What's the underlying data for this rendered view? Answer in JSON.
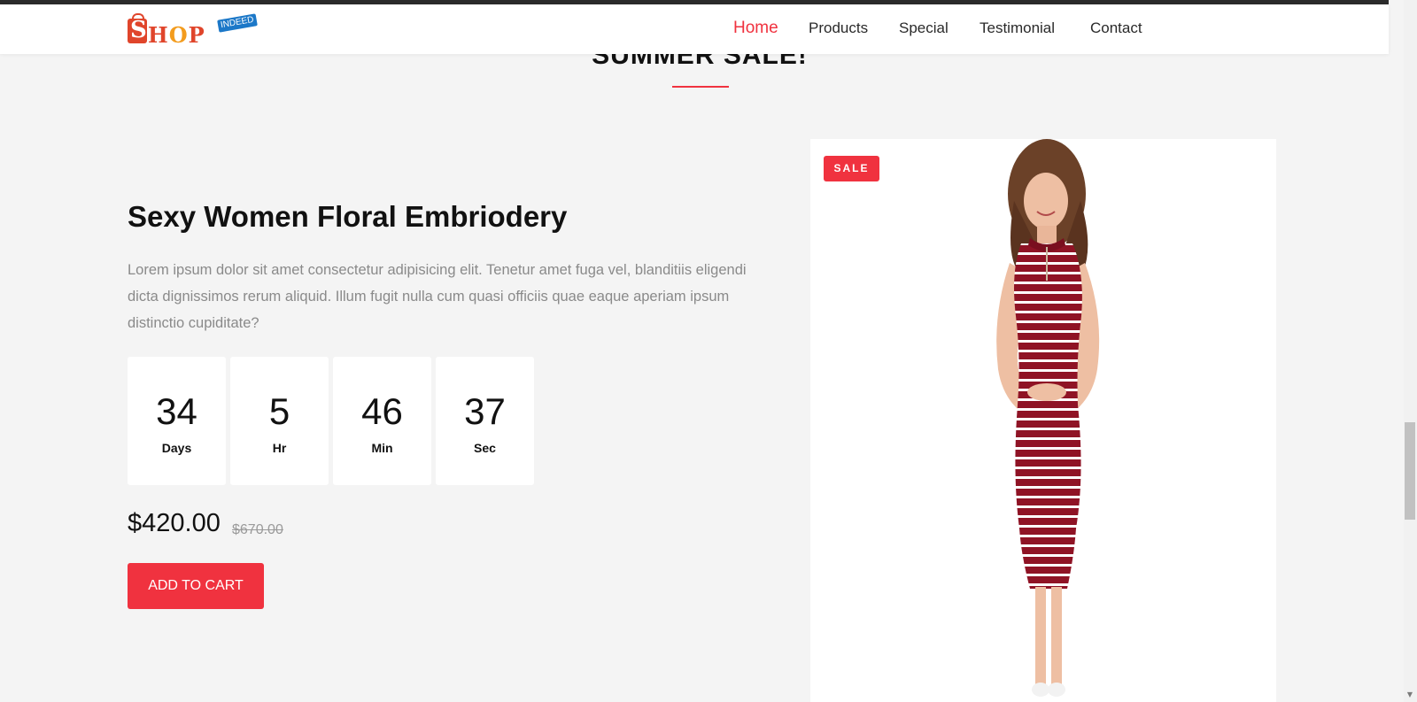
{
  "header": {
    "logo": {
      "text_s": "S",
      "text_rest_1": "H",
      "text_o": "O",
      "text_rest_2": "P",
      "badge": "INDEED"
    },
    "nav": [
      {
        "label": "Home",
        "active": true
      },
      {
        "label": "Products",
        "active": false
      },
      {
        "label": "Special",
        "active": false
      },
      {
        "label": "Testimonial",
        "active": false
      },
      {
        "label": "Contact",
        "active": false
      }
    ]
  },
  "section": {
    "title": "SUMMER SALE!"
  },
  "product": {
    "name": "Sexy Women Floral Embriodery",
    "description": "Lorem ipsum dolor sit amet consectetur adipisicing elit. Tenetur amet fuga vel, blanditiis eligendi dicta dignissimos rerum aliquid. Illum fugit nulla cum quasi officiis quae eaque aperiam ipsum distinctio cupiditate?",
    "countdown": [
      {
        "value": "34",
        "label": "Days"
      },
      {
        "value": "5",
        "label": "Hr"
      },
      {
        "value": "46",
        "label": "Min"
      },
      {
        "value": "37",
        "label": "Sec"
      }
    ],
    "price": "$420.00",
    "old_price": "$670.00",
    "add_to_cart_label": "ADD TO CART",
    "badge": "SALE"
  },
  "colors": {
    "accent": "#f0323f",
    "background": "#f4f4f4",
    "dress_red": "#8f1325"
  }
}
